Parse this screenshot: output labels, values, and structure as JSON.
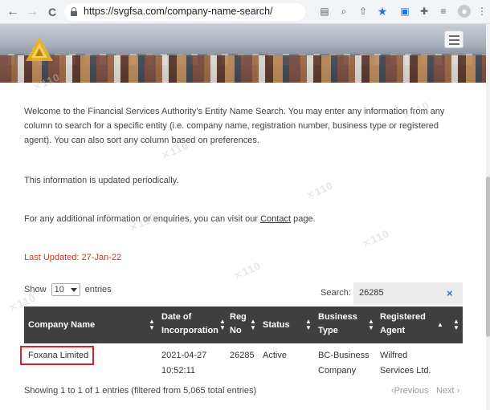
{
  "browser": {
    "url": "https://svgfsa.com/company-name-search/",
    "back_icon": "←",
    "forward_icon": "→",
    "reload_icon": "C",
    "menu_icon": "⋮"
  },
  "site": {
    "accent": "#c0392b",
    "header_color": "#3f3f3f"
  },
  "intro": {
    "paragraph1": "Welcome to the Financial Services Authority's Entity Name Search. You may enter any information from any column to search for a specific entity (i.e. company name, registration number, business type or registered agent). You can also sort any column based on preferences.",
    "paragraph2": "This information is updated periodically.",
    "paragraph3_before": "For any additional information or enquiries, you can visit our ",
    "paragraph3_link": "Contact",
    "paragraph3_after": " page.",
    "last_updated": "Last Updated:  27-Jan-22"
  },
  "controls": {
    "show_label": "Show",
    "page_size": "10",
    "entries_label": "entries",
    "search_label": "Search:",
    "search_value": "26285",
    "clear_icon": "×"
  },
  "table": {
    "headers": {
      "company": "Company Name",
      "date": "Date of Incorporation",
      "reg": "Reg No",
      "status": "Status",
      "business": "Business Type",
      "agent": "Registered Agent"
    },
    "rows": [
      {
        "company": "Foxana Limited",
        "date": "2021-04-27 10:52:11",
        "reg": "26285",
        "status": "Active",
        "business": "BC-Business Company",
        "agent": "Wilfred Services Ltd."
      }
    ]
  },
  "footer": {
    "info": "Showing 1 to 1 of 1 entries (filtered from 5,065 total entries)",
    "previous": "Previous",
    "next": "Next"
  }
}
